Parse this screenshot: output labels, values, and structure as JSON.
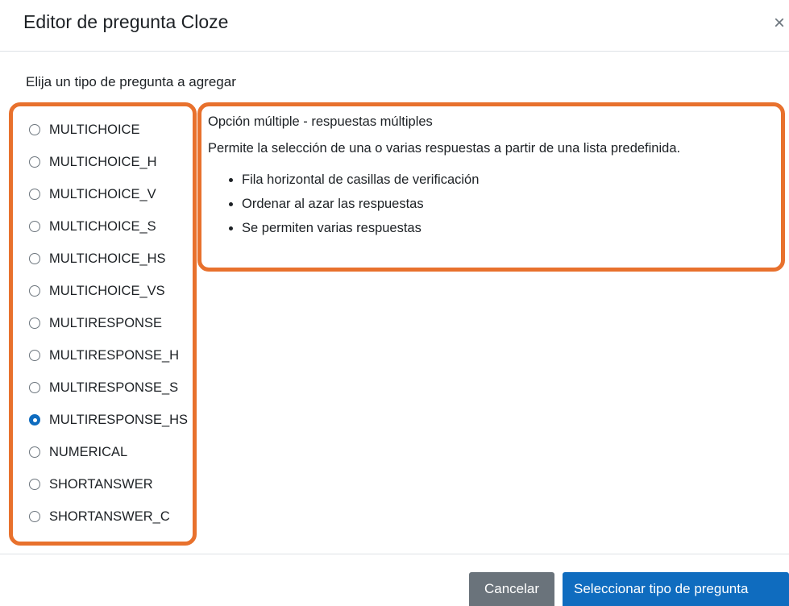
{
  "dialog": {
    "title": "Editor de pregunta Cloze",
    "close_symbol": "×"
  },
  "prompt": "Elija un tipo de pregunta a agregar",
  "question_types": [
    {
      "label": "MULTICHOICE",
      "checked": false
    },
    {
      "label": "MULTICHOICE_H",
      "checked": false
    },
    {
      "label": "MULTICHOICE_V",
      "checked": false
    },
    {
      "label": "MULTICHOICE_S",
      "checked": false
    },
    {
      "label": "MULTICHOICE_HS",
      "checked": false
    },
    {
      "label": "MULTICHOICE_VS",
      "checked": false
    },
    {
      "label": "MULTIRESPONSE",
      "checked": false
    },
    {
      "label": "MULTIRESPONSE_H",
      "checked": false
    },
    {
      "label": "MULTIRESPONSE_S",
      "checked": false
    },
    {
      "label": "MULTIRESPONSE_HS",
      "checked": true
    },
    {
      "label": "NUMERICAL",
      "checked": false
    },
    {
      "label": "SHORTANSWER",
      "checked": false
    },
    {
      "label": "SHORTANSWER_C",
      "checked": false
    }
  ],
  "description": {
    "title": "Opción múltiple - respuestas múltiples",
    "text": "Permite la selección de una o varias respuestas a partir de una lista predefinida.",
    "features": [
      "Fila horizontal de casillas de verificación",
      "Ordenar al azar las respuestas",
      "Se permiten varias respuestas"
    ]
  },
  "footer": {
    "cancel_label": "Cancelar",
    "select_label": "Seleccionar tipo de pregunta"
  },
  "colors": {
    "highlight": "#e8712d",
    "primary": "#0f6cbf",
    "secondary": "#6a737b"
  }
}
